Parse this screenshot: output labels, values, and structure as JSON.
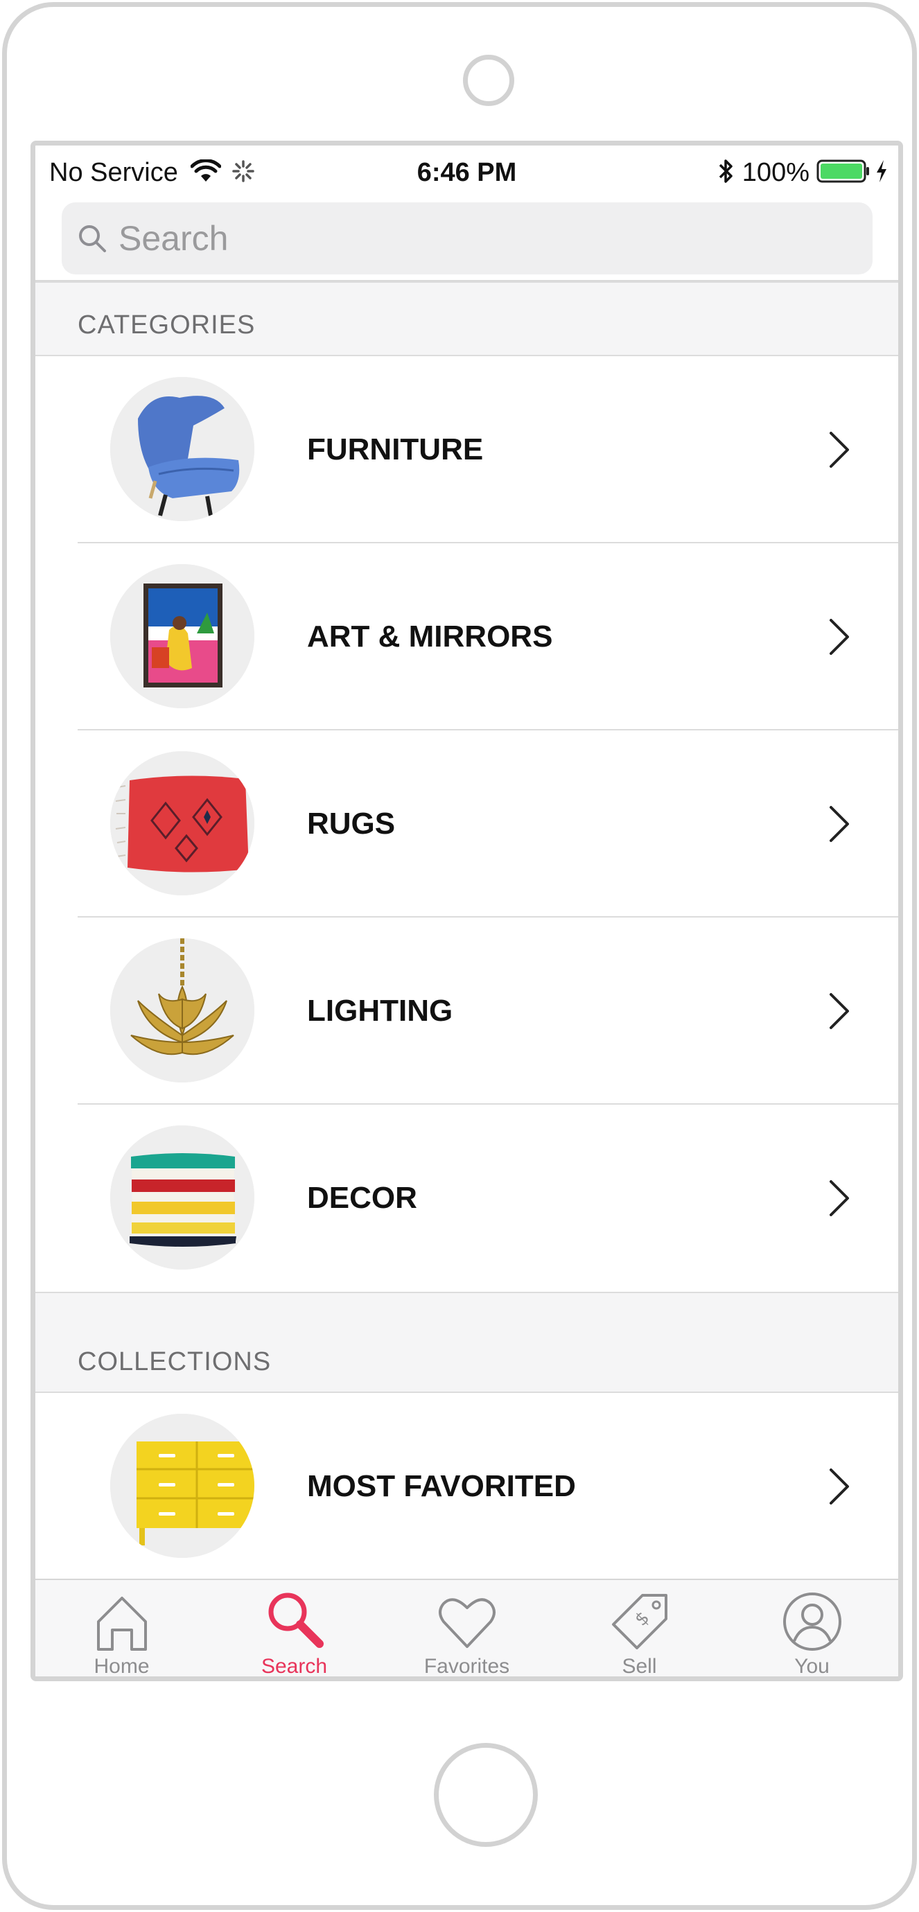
{
  "status_bar": {
    "carrier": "No Service",
    "time": "6:46 PM",
    "battery": "100%"
  },
  "search": {
    "placeholder": "Search"
  },
  "categories": {
    "title": "CATEGORIES",
    "items": [
      {
        "label": "FURNITURE",
        "image": "blue-chair"
      },
      {
        "label": "ART & MIRRORS",
        "image": "framed-art"
      },
      {
        "label": "RUGS",
        "image": "red-rug"
      },
      {
        "label": "LIGHTING",
        "image": "brass-pendant"
      },
      {
        "label": "DECOR",
        "image": "striped-pillow"
      }
    ]
  },
  "collections": {
    "title": "COLLECTIONS",
    "items": [
      {
        "label": "MOST FAVORITED",
        "image": "yellow-dresser"
      }
    ]
  },
  "tab_bar": {
    "tabs": [
      {
        "label": "Home",
        "icon": "house-icon",
        "active": false
      },
      {
        "label": "Search",
        "icon": "magnifier-icon",
        "active": true
      },
      {
        "label": "Favorites",
        "icon": "heart-icon",
        "active": false
      },
      {
        "label": "Sell",
        "icon": "price-tag-icon",
        "active": false
      },
      {
        "label": "You",
        "icon": "user-icon",
        "active": false
      }
    ]
  },
  "colors": {
    "accent": "#e8345a",
    "battery": "#4cd964",
    "section_bg": "#f5f5f6"
  }
}
